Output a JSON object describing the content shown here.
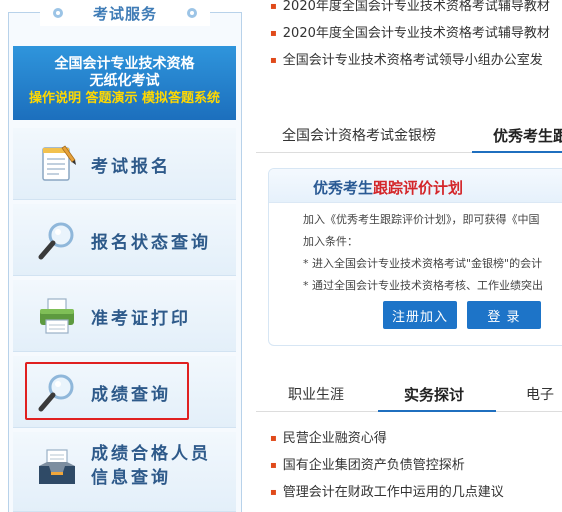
{
  "sidebar": {
    "title": "考试服务",
    "banner": {
      "line1": "全国会计专业技术资格",
      "line2": "无纸化考试",
      "line3": "操作说明 答题演示 模拟答题系统"
    },
    "items": [
      {
        "label": "考试报名",
        "icon": "notepad-icon"
      },
      {
        "label": "报名状态查询",
        "icon": "magnifier-icon"
      },
      {
        "label": "准考证打印",
        "icon": "printer-icon"
      },
      {
        "label": "成绩查询",
        "icon": "magnifier-icon"
      },
      {
        "label1": "成绩合格人员",
        "label2": "信息查询",
        "icon": "inbox-icon"
      }
    ]
  },
  "news_top": [
    "2020年度全国会计专业技术资格考试辅导教材",
    "2020年度全国会计专业技术资格考试辅导教材",
    "全国会计专业技术资格考试领导小组办公室发"
  ],
  "tabs1": {
    "first": "全国会计资格考试金银榜",
    "second": "优秀考生跟"
  },
  "plan": {
    "title_a": "优秀考生",
    "title_b": "跟踪评价计划",
    "line1": "加入《优秀考生跟踪评价计划》，即可获得《中国",
    "line2": "加入条件：",
    "line3": "* 进入全国会计专业技术资格考试\"金银榜\"的会计",
    "line4": "* 通过全国会计专业技术资格考核、工作业绩突出",
    "register_label": "注册加入",
    "login_label": "登 录"
  },
  "tabs2": {
    "first": "职业生涯",
    "second": "实务探讨",
    "third": "电子"
  },
  "news_bottom": [
    "民营企业融资心得",
    "国有企业集团资产负债管控探析",
    "管理会计在财政工作中运用的几点建议"
  ],
  "colors": {
    "accent": "#1f6fbf",
    "highlight": "#e02020",
    "bullet": "#e04a1a"
  }
}
